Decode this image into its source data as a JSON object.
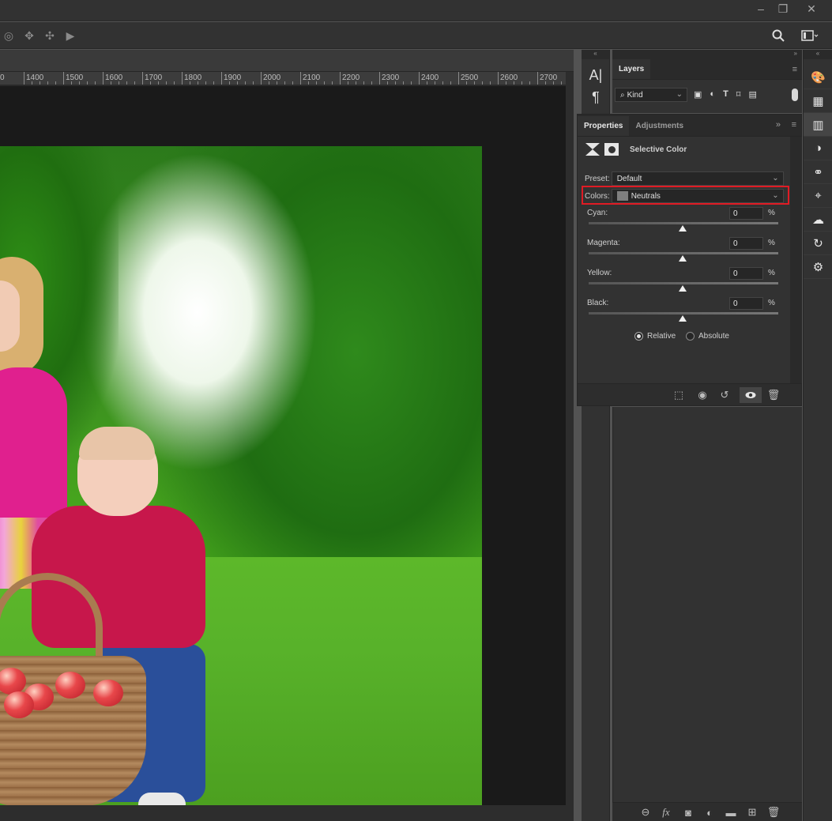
{
  "window": {
    "min": "–",
    "restore": "❐",
    "close": "✕"
  },
  "options_bar": {
    "icons": [
      "3d-orbit-icon",
      "3d-pan-icon",
      "3d-drag-icon",
      "video-camera-icon"
    ],
    "search_icon": "search-icon",
    "workspace_icon": "workspace-icon"
  },
  "ruler": {
    "labels": [
      "1400",
      "1500",
      "1600",
      "1700",
      "1800",
      "1900",
      "2000",
      "2100",
      "2200",
      "2300",
      "2400",
      "2500",
      "2600",
      "2700"
    ]
  },
  "collapse": {
    "left": "«",
    "right": "»"
  },
  "side_tools": {
    "character": "A|",
    "paragraph": "¶"
  },
  "layers": {
    "tab": "Layers",
    "filter_kind": "Kind",
    "filter_icons": [
      "image-filter-icon",
      "adjustment-filter-icon",
      "type-filter-icon",
      "shape-filter-icon",
      "smart-object-filter-icon"
    ],
    "footer_icons": [
      "link-layers-icon",
      "fx-icon",
      "add-mask-icon",
      "new-adjustment-icon",
      "new-group-icon",
      "new-layer-icon",
      "trash-icon"
    ],
    "fx_label": "fx"
  },
  "properties": {
    "tab_properties": "Properties",
    "tab_adjustments": "Adjustments",
    "title": "Selective Color",
    "preset_label": "Preset:",
    "preset_value": "Default",
    "colors_label": "Colors:",
    "colors_value": "Neutrals",
    "colors_swatch": "#7f7f7f",
    "sliders": [
      {
        "label": "Cyan:",
        "value": "0",
        "unit": "%"
      },
      {
        "label": "Magenta:",
        "value": "0",
        "unit": "%"
      },
      {
        "label": "Yellow:",
        "value": "0",
        "unit": "%"
      },
      {
        "label": "Black:",
        "value": "0",
        "unit": "%"
      }
    ],
    "method": {
      "relative": "Relative",
      "absolute": "Absolute",
      "selected": "Relative"
    },
    "footer_icons": [
      "clip-to-layer-icon",
      "view-previous-icon",
      "reset-icon",
      "visibility-icon",
      "trash-icon"
    ],
    "highlight_color": "#e01b24"
  },
  "right_icons": [
    "color-icon",
    "swatches-icon",
    "properties-icon",
    "adjustments-icon",
    "channels-icon",
    "paths-icon",
    "libraries-icon",
    "history-icon",
    "actions-icon"
  ]
}
